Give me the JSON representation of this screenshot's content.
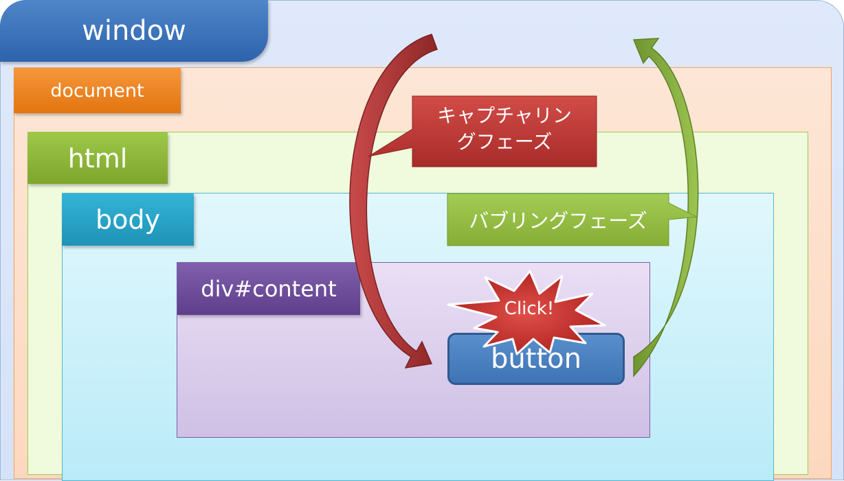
{
  "layers": {
    "window": "window",
    "document": "document",
    "html": "html",
    "body": "body",
    "div": "div#content",
    "button": "button"
  },
  "callouts": {
    "capturing": [
      "キャプチャリン",
      "グフェーズ"
    ],
    "bubbling": "バブリングフェーズ",
    "click": "Click!"
  },
  "colors": {
    "window": "#3a72b8",
    "document": "#ec8523",
    "html": "#8cb73c",
    "body": "#28a3c7",
    "div": "#6d4e9c",
    "button": "#4a80c2",
    "capture_arrow": "#a93a3a",
    "bubble_arrow": "#7ea33a",
    "click_burst": "#c8312f"
  }
}
